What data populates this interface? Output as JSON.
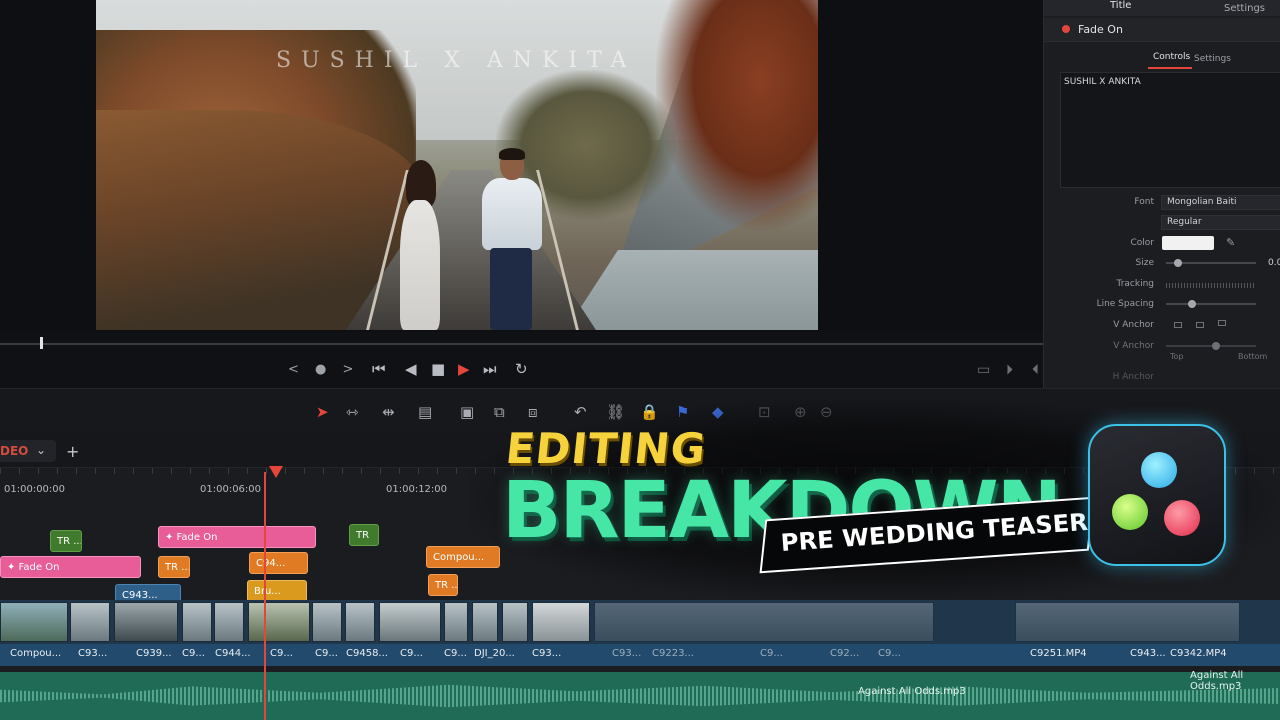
{
  "viewer": {
    "video_title": "SUSHIL X ANKITA",
    "jog_label": "< ● >"
  },
  "transport": {
    "first_frame": "⏮",
    "prev_frame": "◀",
    "stop": "■",
    "play": "▶",
    "last_frame": "⏭",
    "loop": "↻"
  },
  "inspector": {
    "tab_title": "Title",
    "tab_settings": "Settings",
    "effect_name": "Fade On",
    "sub_controls": "Controls",
    "sub_settings": "Settings",
    "text_content": "SUSHIL X ANKITA",
    "font_label": "Font",
    "font_value": "Mongolian Baiti",
    "style_value": "Regular",
    "color_label": "Color",
    "size_label": "Size",
    "size_value": "0.0",
    "tracking_label": "Tracking",
    "line_spacing_label": "Line Spacing",
    "v_anchor_label_1": "V Anchor",
    "v_anchor_label_2": "V Anchor",
    "top_label": "Top",
    "bottom_label": "Bottom",
    "h_anchor_label": "H Anchor",
    "color_value": "#f1f1f1"
  },
  "timeline": {
    "track_name": "DEO",
    "track_dropdown": "⌄",
    "add_label": "+",
    "timecodes": [
      "01:00:00:00",
      "01:00:06:00",
      "01:00:12:00"
    ],
    "clips": {
      "fade_on_1": "✦ Fade On",
      "fade_on_2": "✦ Fade On",
      "tr_1": "TR ...",
      "tr_2": "TR ...",
      "tr_3": "TR",
      "tr_4": "TR ...",
      "c94": "C94...",
      "bru": "Bru...",
      "c943_top": "C943...",
      "compou_top": "Compou..."
    },
    "video_labels": [
      "Compou...",
      "C93...",
      "C939...",
      "C9...",
      "C944...",
      "C9...",
      "C9...",
      "C9458...",
      "C9...",
      "C9...",
      "DJI_20...",
      "C93...",
      "C93...",
      "C9223...",
      "C9...",
      "C92...",
      "C9...",
      "C9251.MP4",
      "C943...",
      "C9342.MP4"
    ],
    "audio_labels": [
      "Against All Odds.mp3",
      "Against All Odds.mp3"
    ]
  },
  "overlay": {
    "line1": "EDITING",
    "line2": "BREAKDOWN",
    "banner": "PRE WEDDING TEASER"
  },
  "colors": {
    "accent_red": "#e4463b",
    "title_green": "#46e6a7",
    "title_yellow": "#f6d33c"
  }
}
